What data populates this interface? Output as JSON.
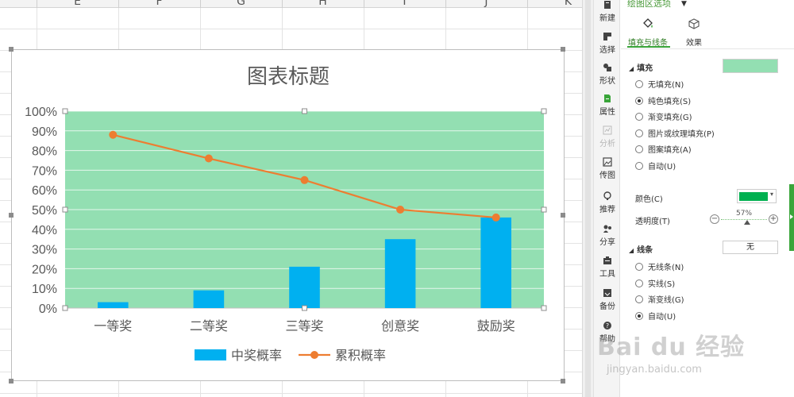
{
  "sheet": {
    "columns": [
      "E",
      "F",
      "G",
      "H",
      "I",
      "J",
      "K"
    ]
  },
  "chart_data": {
    "type": "bar",
    "title": "图表标题",
    "categories": [
      "一等奖",
      "二等奖",
      "三等奖",
      "创意奖",
      "鼓励奖"
    ],
    "series": [
      {
        "name": "中奖概率",
        "type": "bar",
        "color": "#00b0f0",
        "values": [
          3,
          9,
          21,
          35,
          46
        ]
      },
      {
        "name": "累积概率",
        "type": "line",
        "color": "#ed7d31",
        "values": [
          88,
          76,
          65,
          50,
          46
        ]
      }
    ],
    "y_ticks": [
      "0%",
      "10%",
      "20%",
      "30%",
      "40%",
      "50%",
      "60%",
      "70%",
      "80%",
      "90%",
      "100%"
    ],
    "ylim": [
      0,
      100
    ],
    "y_unit": "%",
    "plot_area_fill": "#93dfb2",
    "gridlines": true,
    "legend_position": "bottom"
  },
  "toolbar": {
    "items": [
      {
        "label": "新建",
        "icon": "new-chart-icon",
        "state": "normal"
      },
      {
        "label": "选择",
        "icon": "select-icon",
        "state": "normal"
      },
      {
        "label": "形状",
        "icon": "shapes-icon",
        "state": "normal"
      },
      {
        "label": "属性",
        "icon": "properties-icon",
        "state": "active"
      },
      {
        "label": "分析",
        "icon": "analysis-icon",
        "state": "disabled"
      },
      {
        "label": "传图",
        "icon": "upload-image-icon",
        "state": "normal"
      },
      {
        "label": "推荐",
        "icon": "recommend-icon",
        "state": "normal"
      },
      {
        "label": "分享",
        "icon": "share-icon",
        "state": "normal"
      },
      {
        "label": "工具",
        "icon": "tools-icon",
        "state": "normal"
      },
      {
        "label": "备份",
        "icon": "backup-icon",
        "state": "normal"
      },
      {
        "label": "帮助",
        "icon": "help-icon",
        "state": "normal"
      }
    ]
  },
  "pane": {
    "title": "绘图区选项",
    "tabs": [
      {
        "label": "填充与线条",
        "icon": "paint-bucket-icon",
        "active": true
      },
      {
        "label": "效果",
        "icon": "cube-effect-icon",
        "active": false
      }
    ],
    "fill": {
      "heading": "填充",
      "swatch_color": "#93dfb2",
      "options": [
        {
          "label": "无填充(N)",
          "checked": false
        },
        {
          "label": "纯色填充(S)",
          "checked": true
        },
        {
          "label": "渐变填充(G)",
          "checked": false
        },
        {
          "label": "图片或纹理填充(P)",
          "checked": false
        },
        {
          "label": "图案填充(A)",
          "checked": false
        },
        {
          "label": "自动(U)",
          "checked": false
        }
      ],
      "color_label": "颜色(C)",
      "color_value": "#00b050",
      "transparency_label": "透明度(T)",
      "transparency_value": "57%",
      "transparency_fraction": 0.57
    },
    "line": {
      "heading": "线条",
      "value": "无",
      "options": [
        {
          "label": "无线条(N)",
          "checked": false
        },
        {
          "label": "实线(S)",
          "checked": false
        },
        {
          "label": "渐变线(G)",
          "checked": false
        },
        {
          "label": "自动(U)",
          "checked": true
        }
      ]
    }
  },
  "watermark": {
    "logo": "Bai du 经验",
    "url": "jingyan.baidu.com"
  },
  "colors": {
    "accent_green": "#3aa53a",
    "bar_blue": "#00b0f0",
    "line_orange": "#ed7d31"
  }
}
